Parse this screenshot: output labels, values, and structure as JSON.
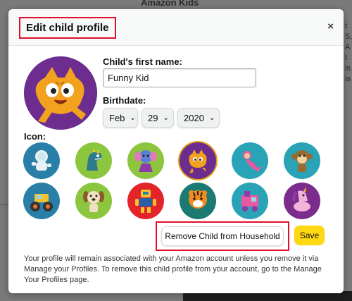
{
  "background": {
    "page_title": "Amazon Kids",
    "side_text": [
      "t",
      "S,",
      "A",
      "",
      "",
      "t",
      "is",
      "",
      "",
      "is",
      ""
    ]
  },
  "modal": {
    "title": "Edit child profile",
    "close_label": "×",
    "first_name_label": "Child's first name:",
    "first_name_value": "Funny Kid",
    "birthdate_label": "Birthdate:",
    "birth_month": "Feb",
    "birth_day": "29",
    "birth_year": "2020",
    "icon_label": "Icon:",
    "icons": [
      {
        "name": "astronaut-icon",
        "bg": "#2a7fa8"
      },
      {
        "name": "dinosaur-icon",
        "bg": "#8cc63f"
      },
      {
        "name": "elephant-icon",
        "bg": "#8cc63f"
      },
      {
        "name": "cat-icon",
        "bg": "#6c2d8f",
        "selected": true
      },
      {
        "name": "mermaid-icon",
        "bg": "#29a3b5"
      },
      {
        "name": "monkey-icon",
        "bg": "#29a3b5"
      },
      {
        "name": "monster-truck-icon",
        "bg": "#2a7fa8"
      },
      {
        "name": "puppy-icon",
        "bg": "#8cc63f"
      },
      {
        "name": "robot-icon",
        "bg": "#e3242b"
      },
      {
        "name": "tiger-icon",
        "bg": "#1c7a73"
      },
      {
        "name": "train-icon",
        "bg": "#29a3b5"
      },
      {
        "name": "unicorn-icon",
        "bg": "#7b2c8c"
      }
    ],
    "remove_button": "Remove Child from Household",
    "save_button": "Save",
    "footnote": "Your profile will remain associated with your Amazon account unless you remove it via Manage your Profiles. To remove this child profile from your account, go to the Manage Your Profiles page."
  },
  "colors": {
    "highlight_box": "#e0102a",
    "save_yellow": "#ffd814",
    "selected_ring": "#e3a11a"
  }
}
